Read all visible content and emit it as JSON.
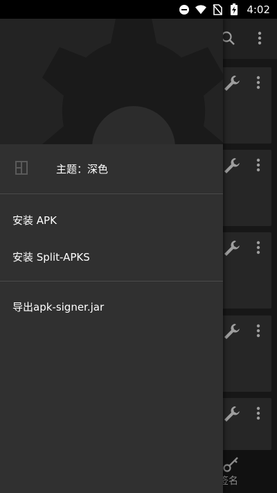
{
  "status_bar": {
    "time": "4:02",
    "icons": [
      "do-not-disturb-icon",
      "wifi-icon",
      "no-sim-icon",
      "battery-charging-icon"
    ]
  },
  "toolbar": {
    "icons": [
      "search-icon",
      "more-vert-icon"
    ]
  },
  "cards": [
    {
      "icons": [
        "wrench-icon",
        "more-vert-icon"
      ]
    },
    {
      "icons": [
        "wrench-icon",
        "more-vert-icon"
      ]
    },
    {
      "icons": [
        "wrench-icon",
        "more-vert-icon"
      ]
    },
    {
      "icons": [
        "wrench-icon",
        "more-vert-icon"
      ]
    },
    {
      "icons": [
        "wrench-icon",
        "more-vert-icon"
      ]
    }
  ],
  "bottom_nav": {
    "sign_label": "签名"
  },
  "drawer": {
    "header_icon": "gear-icon",
    "theme_label": "主题：深色",
    "items": [
      {
        "label": "安装 APK"
      },
      {
        "label": "安装 Split-APKS"
      },
      {
        "label": "导出apk-signer.jar"
      }
    ]
  },
  "colors": {
    "drawer_bg": "#303030",
    "header_bg": "#232323",
    "icon_gray": "#9e9e9e"
  }
}
